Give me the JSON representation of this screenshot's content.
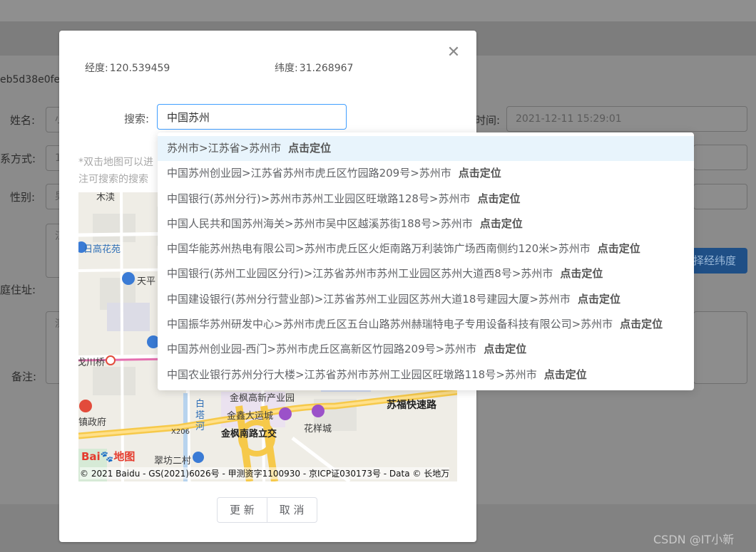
{
  "background": {
    "id_fragment": "eb5d38e0fe",
    "form_labels": {
      "name": "姓名:",
      "contact": "系方式:",
      "gender": "性别:",
      "address": "庭住址:",
      "remark": "备注:"
    },
    "name_value": "小",
    "contact_value": "1",
    "gender_value": "男",
    "address_value": "江",
    "remark_value": "测",
    "time_label": "时间:",
    "time_value": "2021-12-11 15:29:01",
    "select_coords_button": "择经纬度"
  },
  "dialog": {
    "longitude_label": "经度:",
    "longitude_value": "120.539459",
    "latitude_label": "纬度:",
    "latitude_value": "31.268967",
    "search_label": "搜索:",
    "search_value": "中国苏州",
    "hint_line1": "*双击地图可以进",
    "hint_line2": "注可搜索的搜索",
    "buttons": {
      "update": "更 新",
      "cancel": "取 消"
    }
  },
  "map": {
    "labels": [
      "木渎",
      "日高花苑",
      "天平",
      "金枫高新产业园",
      "金鑫大运城",
      "花样城",
      "金枫南路立交",
      "苏福快速路",
      "镇政府",
      "翠坊二村",
      "白塔河",
      "X206",
      "戈川桥"
    ],
    "logo_text": "Bai",
    "logo_map": "地图",
    "copyright": "© 2021 Baidu - GS(2021)6026号 - 甲测资字1100930 - 京ICP证030173号 - Data © 长地万"
  },
  "suggestions": [
    {
      "text": "苏州市>江苏省>苏州市",
      "action": "点击定位"
    },
    {
      "text": "中国苏州创业园>江苏省苏州市虎丘区竹园路209号>苏州市",
      "action": "点击定位"
    },
    {
      "text": "中国银行(苏州分行)>苏州市苏州工业园区旺墩路128号>苏州市",
      "action": "点击定位"
    },
    {
      "text": "中国人民共和国苏州海关>苏州市吴中区越溪苏街188号>苏州市",
      "action": "点击定位"
    },
    {
      "text": "中国华能苏州热电有限公司>苏州市虎丘区火炬南路万利装饰广场西南侧约120米>苏州市",
      "action": "点击定位"
    },
    {
      "text": "中国银行(苏州工业园区分行)>江苏省苏州市苏州工业园区苏州大道西8号>苏州市",
      "action": "点击定位"
    },
    {
      "text": "中国建设银行(苏州分行营业部)>江苏省苏州工业园区苏州大道18号建园大厦>苏州市",
      "action": "点击定位"
    },
    {
      "text": "中国振华苏州研发中心>苏州市虎丘区五台山路苏州赫瑞特电子专用设备科技有限公司>苏州市",
      "action": "点击定位"
    },
    {
      "text": "中国苏州创业园-西门>苏州市虎丘区高新区竹园路209号>苏州市",
      "action": "点击定位"
    },
    {
      "text": "中国农业银行苏州分行大楼>江苏省苏州市苏州工业园区旺墩路118号>苏州市",
      "action": "点击定位"
    }
  ],
  "watermark": "CSDN @IT小新",
  "colors": {
    "accent": "#409eff",
    "overlay_bg": "#878787",
    "dropdown_active": "#e8f4fc"
  }
}
